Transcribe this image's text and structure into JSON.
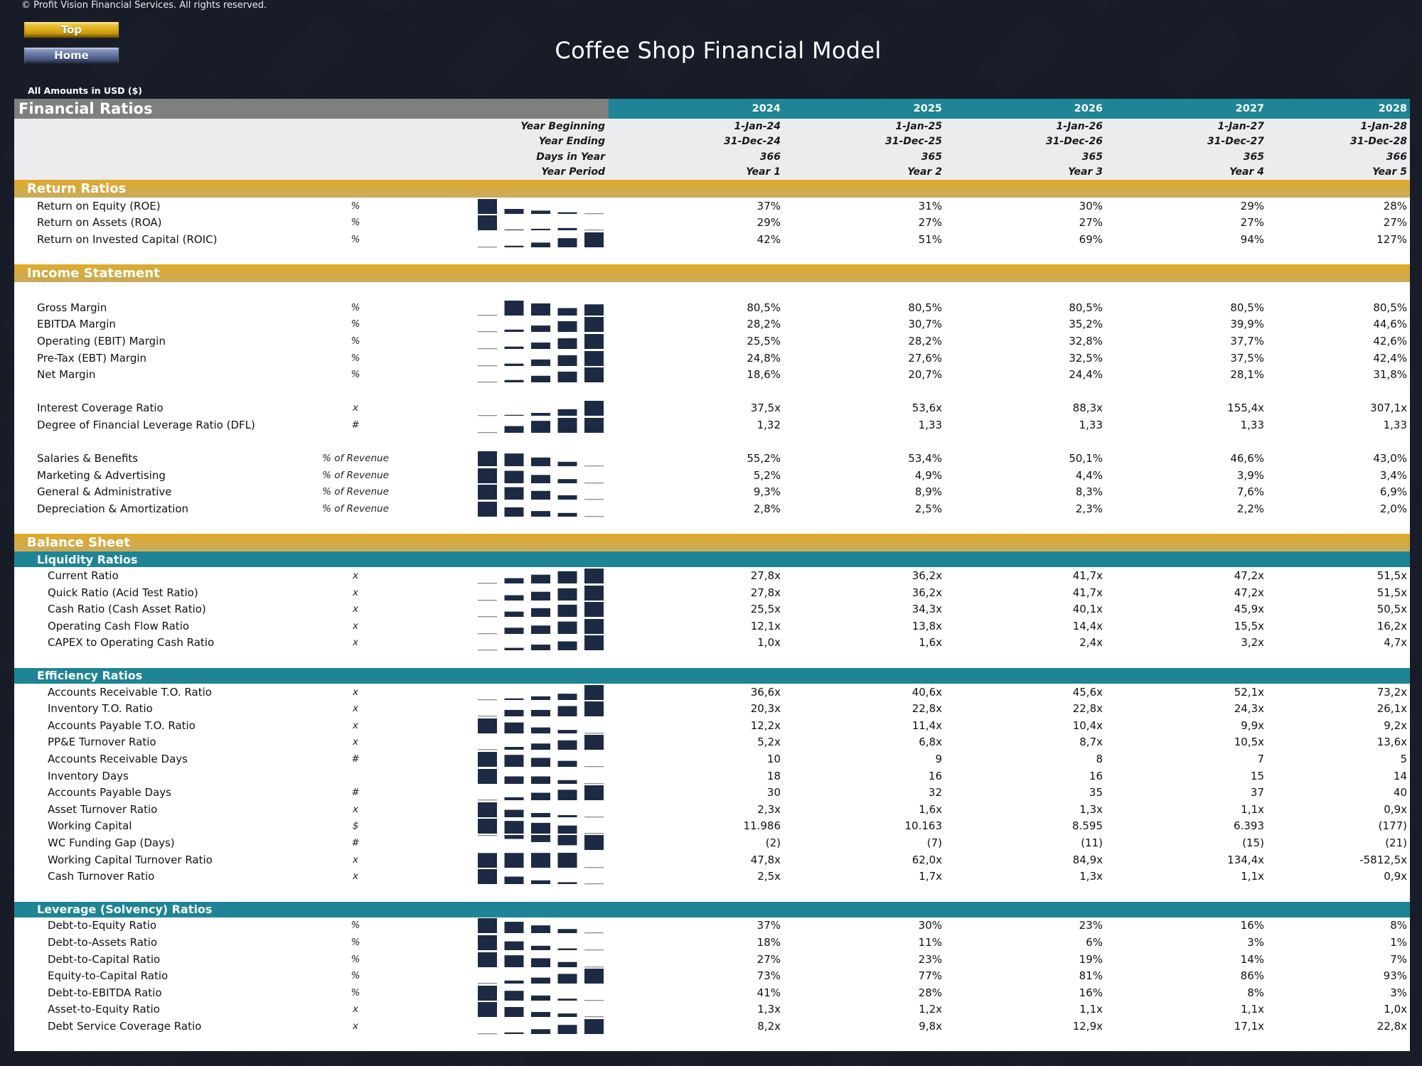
{
  "header": {
    "copyright": "© Profit Vision Financial Services. All rights reserved.",
    "buttons": {
      "top": "Top",
      "home": "Home"
    },
    "app_title": "Coffee Shop Financial Model",
    "amounts_note": "All Amounts in  USD ($)"
  },
  "table": {
    "title": "Financial Ratios",
    "years": [
      "2024",
      "2025",
      "2026",
      "2027",
      "2028"
    ],
    "period_rows": [
      {
        "label": "Year Beginning",
        "values": [
          "1-Jan-24",
          "1-Jan-25",
          "1-Jan-26",
          "1-Jan-27",
          "1-Jan-28"
        ]
      },
      {
        "label": "Year Ending",
        "values": [
          "31-Dec-24",
          "31-Dec-25",
          "31-Dec-26",
          "31-Dec-27",
          "31-Dec-28"
        ]
      },
      {
        "label": "Days in Year",
        "values": [
          "366",
          "365",
          "365",
          "365",
          "366"
        ]
      },
      {
        "label": "Year Period",
        "values": [
          "Year 1",
          "Year 2",
          "Year 3",
          "Year 4",
          "Year 5"
        ]
      }
    ],
    "colors": {
      "gold": "#d9a82a",
      "teal": "#1e8496",
      "grey": "#7f7f7f",
      "spark": "#1d2a44",
      "background": "#171c29"
    }
  },
  "sections": [
    {
      "title": "Return Ratios",
      "style": "gold",
      "groups": [
        {
          "rows": [
            {
              "name": "Return on Equity (ROE)",
              "unit": "%",
              "values": [
                "37%",
                "31%",
                "30%",
                "29%",
                "28%"
              ],
              "spark": [
                37,
                31,
                30,
                29,
                28
              ]
            },
            {
              "name": "Return on Assets (ROA)",
              "unit": "%",
              "values": [
                "29%",
                "27%",
                "27%",
                "27%",
                "27%"
              ],
              "spark": [
                29,
                27.1,
                27.2,
                27.3,
                27
              ]
            },
            {
              "name": "Return on Invested Capital (ROIC)",
              "unit": "%",
              "values": [
                "42%",
                "51%",
                "69%",
                "94%",
                "127%"
              ],
              "spark": [
                42,
                51,
                69,
                94,
                127
              ]
            }
          ]
        }
      ]
    },
    {
      "title": "Income Statement",
      "style": "gold",
      "leading_blank": true,
      "groups": [
        {
          "rows": [
            {
              "name": "Gross Margin",
              "unit": "%",
              "values": [
                "80,5%",
                "80,5%",
                "80,5%",
                "80,5%",
                "80,5%"
              ],
              "spark": [
                80.4,
                80.56,
                80.53,
                80.48,
                80.52
              ]
            },
            {
              "name": "EBITDA Margin",
              "unit": "%",
              "values": [
                "28,2%",
                "30,7%",
                "35,2%",
                "39,9%",
                "44,6%"
              ],
              "spark": [
                28.2,
                30.7,
                35.2,
                39.9,
                44.6
              ]
            },
            {
              "name": "Operating (EBIT) Margin",
              "unit": "%",
              "values": [
                "25,5%",
                "28,2%",
                "32,8%",
                "37,7%",
                "42,6%"
              ],
              "spark": [
                25.5,
                28.2,
                32.8,
                37.7,
                42.6
              ]
            },
            {
              "name": "Pre-Tax (EBT) Margin",
              "unit": "%",
              "values": [
                "24,8%",
                "27,6%",
                "32,5%",
                "37,5%",
                "42,4%"
              ],
              "spark": [
                24.8,
                27.6,
                32.5,
                37.5,
                42.4
              ]
            },
            {
              "name": "Net Margin",
              "unit": "%",
              "values": [
                "18,6%",
                "20,7%",
                "24,4%",
                "28,1%",
                "31,8%"
              ],
              "spark": [
                18.6,
                20.7,
                24.4,
                28.1,
                31.8
              ]
            }
          ]
        },
        {
          "rows": [
            {
              "name": "Interest Coverage Ratio",
              "unit": "x",
              "values": [
                "37,5x",
                "53,6x",
                "88,3x",
                "155,4x",
                "307,1x"
              ],
              "spark": [
                37.5,
                53.6,
                88.3,
                155.4,
                307.1
              ]
            },
            {
              "name": "Degree of Financial Leverage Ratio (DFL)",
              "unit": "#",
              "values": [
                "1,32",
                "1,33",
                "1,33",
                "1,33",
                "1,33"
              ],
              "spark": [
                1.322,
                1.3265,
                1.33,
                1.332,
                1.332
              ]
            }
          ]
        },
        {
          "rows": [
            {
              "name": "Salaries & Benefits",
              "unit": "% of Revenue",
              "values": [
                "55,2%",
                "53,4%",
                "50,1%",
                "46,6%",
                "43,0%"
              ],
              "spark": [
                55.2,
                53.4,
                50.1,
                46.6,
                43.0
              ]
            },
            {
              "name": "Marketing & Advertising",
              "unit": "% of Revenue",
              "values": [
                "5,2%",
                "4,9%",
                "4,4%",
                "3,9%",
                "3,4%"
              ],
              "spark": [
                5.2,
                4.9,
                4.4,
                3.9,
                3.4
              ]
            },
            {
              "name": "General & Administrative",
              "unit": "% of Revenue",
              "values": [
                "9,3%",
                "8,9%",
                "8,3%",
                "7,6%",
                "6,9%"
              ],
              "spark": [
                9.3,
                8.9,
                8.3,
                7.6,
                6.9
              ]
            },
            {
              "name": "Depreciation & Amortization",
              "unit": "% of Revenue",
              "values": [
                "2,8%",
                "2,5%",
                "2,3%",
                "2,2%",
                "2,0%"
              ],
              "spark": [
                2.8,
                2.5,
                2.3,
                2.2,
                2.0
              ]
            }
          ]
        }
      ]
    },
    {
      "title": "Balance Sheet",
      "style": "gold",
      "subsections": [
        {
          "title": "Liquidity Ratios",
          "rows": [
            {
              "name": "Current Ratio",
              "unit": "x",
              "values": [
                "27,8x",
                "36,2x",
                "41,7x",
                "47,2x",
                "51,5x"
              ],
              "spark": [
                27.8,
                36.2,
                41.7,
                47.2,
                51.5
              ]
            },
            {
              "name": "Quick Ratio (Acid Test Ratio)",
              "unit": "x",
              "values": [
                "27,8x",
                "36,2x",
                "41,7x",
                "47,2x",
                "51,5x"
              ],
              "spark": [
                27.8,
                36.2,
                41.7,
                47.2,
                51.5
              ]
            },
            {
              "name": "Cash Ratio (Cash Asset Ratio)",
              "unit": "x",
              "values": [
                "25,5x",
                "34,3x",
                "40,1x",
                "45,9x",
                "50,5x"
              ],
              "spark": [
                25.5,
                34.3,
                40.1,
                45.9,
                50.5
              ]
            },
            {
              "name": "Operating Cash Flow Ratio",
              "unit": "x",
              "values": [
                "12,1x",
                "13,8x",
                "14,4x",
                "15,5x",
                "16,2x"
              ],
              "spark": [
                12.1,
                13.8,
                14.4,
                15.5,
                16.2
              ]
            },
            {
              "name": "CAPEX to Operating Cash Ratio",
              "unit": "x",
              "values": [
                "1,0x",
                "1,6x",
                "2,4x",
                "3,2x",
                "4,7x"
              ],
              "spark": [
                1.0,
                1.6,
                2.4,
                3.2,
                4.7
              ]
            }
          ]
        },
        {
          "title": "Efficiency Ratios",
          "rows": [
            {
              "name": "Accounts Receivable T.O. Ratio",
              "unit": "x",
              "values": [
                "36,6x",
                "40,6x",
                "45,6x",
                "52,1x",
                "73,2x"
              ],
              "spark": [
                36.6,
                40.6,
                45.6,
                52.1,
                73.2
              ]
            },
            {
              "name": "Inventory T.O. Ratio",
              "unit": "x",
              "values": [
                "20,3x",
                "22,8x",
                "22,8x",
                "24,3x",
                "26,1x"
              ],
              "spark": [
                20.3,
                22.8,
                22.8,
                24.3,
                26.1
              ]
            },
            {
              "name": "Accounts Payable T.O. Ratio",
              "unit": "x",
              "values": [
                "12,2x",
                "11,4x",
                "10,4x",
                "9,9x",
                "9,2x"
              ],
              "spark": [
                12.2,
                11.4,
                10.4,
                9.9,
                9.2
              ]
            },
            {
              "name": "PP&E Turnover Ratio",
              "unit": "x",
              "values": [
                "5,2x",
                "6,8x",
                "8,7x",
                "10,5x",
                "13,6x"
              ],
              "spark": [
                5.2,
                6.8,
                8.7,
                10.5,
                13.6
              ]
            },
            {
              "name": "Accounts Receivable Days",
              "unit": "#",
              "values": [
                "10",
                "9",
                "8",
                "7",
                "5"
              ],
              "spark": [
                10,
                9,
                8,
                7,
                5
              ]
            },
            {
              "name": "Inventory Days",
              "unit": "",
              "values": [
                "18",
                "16",
                "16",
                "15",
                "14"
              ],
              "spark": [
                18,
                16,
                16,
                15,
                14
              ]
            },
            {
              "name": "Accounts Payable Days",
              "unit": "#",
              "values": [
                "30",
                "32",
                "35",
                "37",
                "40"
              ],
              "spark": [
                30,
                32,
                35,
                37,
                40
              ]
            },
            {
              "name": "Asset Turnover Ratio",
              "unit": "x",
              "values": [
                "2,3x",
                "1,6x",
                "1,3x",
                "1,1x",
                "0,9x"
              ],
              "spark": [
                2.3,
                1.6,
                1.3,
                1.1,
                0.9
              ]
            },
            {
              "name": "Working Capital",
              "unit": "$",
              "values": [
                "11.986",
                "10.163",
                "8.595",
                "6.393",
                "(177)"
              ],
              "spark": [
                11986,
                10163,
                8595,
                6393,
                -177
              ]
            },
            {
              "name": "WC Funding Gap (Days)",
              "unit": "#",
              "values": [
                "(2)",
                "(7)",
                "(11)",
                "(15)",
                "(21)"
              ],
              "spark": [
                -2,
                -7,
                -11,
                -15,
                -21
              ]
            },
            {
              "name": "Working Capital Turnover Ratio",
              "unit": "x",
              "values": [
                "47,8x",
                "62,0x",
                "84,9x",
                "134,4x",
                "-5812,5x"
              ],
              "spark": [
                47.8,
                62.0,
                84.9,
                134.4,
                -5812.5
              ]
            },
            {
              "name": "Cash Turnover Ratio",
              "unit": "x",
              "values": [
                "2,5x",
                "1,7x",
                "1,3x",
                "1,1x",
                "0,9x"
              ],
              "spark": [
                2.5,
                1.7,
                1.3,
                1.1,
                0.9
              ]
            }
          ]
        },
        {
          "title": "Leverage (Solvency) Ratios",
          "rows": [
            {
              "name": "Debt-to-Equity Ratio",
              "unit": "%",
              "values": [
                "37%",
                "30%",
                "23%",
                "16%",
                "8%"
              ],
              "spark": [
                37,
                30,
                23,
                16,
                8
              ]
            },
            {
              "name": "Debt-to-Assets Ratio",
              "unit": "%",
              "values": [
                "18%",
                "11%",
                "6%",
                "3%",
                "1%"
              ],
              "spark": [
                18,
                11,
                6,
                3,
                1
              ]
            },
            {
              "name": "Debt-to-Capital Ratio",
              "unit": "%",
              "values": [
                "27%",
                "23%",
                "19%",
                "14%",
                "7%"
              ],
              "spark": [
                27,
                23,
                19,
                14,
                7
              ]
            },
            {
              "name": "Equity-to-Capital Ratio",
              "unit": "%",
              "values": [
                "73%",
                "77%",
                "81%",
                "86%",
                "93%"
              ],
              "spark": [
                73,
                77,
                81,
                86,
                93
              ]
            },
            {
              "name": "Debt-to-EBITDA Ratio",
              "unit": "%",
              "values": [
                "41%",
                "28%",
                "16%",
                "8%",
                "3%"
              ],
              "spark": [
                41,
                28,
                16,
                8,
                3
              ]
            },
            {
              "name": "Asset-to-Equity Ratio",
              "unit": "x",
              "values": [
                "1,3x",
                "1,2x",
                "1,1x",
                "1,1x",
                "1,0x"
              ],
              "spark": [
                1.3,
                1.2,
                1.1,
                1.07,
                1.0
              ]
            },
            {
              "name": "Debt Service Coverage Ratio",
              "unit": "x",
              "values": [
                "8,2x",
                "9,8x",
                "12,9x",
                "17,1x",
                "22,8x"
              ],
              "spark": [
                8.2,
                9.8,
                12.9,
                17.1,
                22.8
              ]
            }
          ]
        }
      ]
    }
  ]
}
